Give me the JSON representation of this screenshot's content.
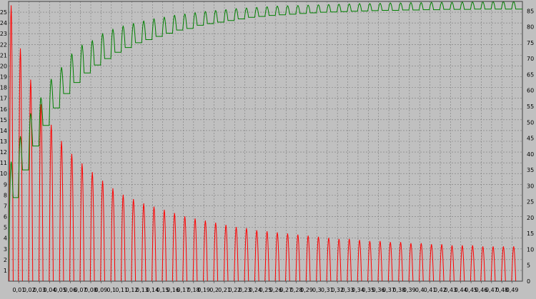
{
  "chart_data": {
    "type": "line",
    "xlabel": "",
    "ylabel_left": "",
    "ylabel_right": "",
    "x_range": [
      0,
      0.5
    ],
    "y_left_range": [
      0,
      26
    ],
    "y_right_range": [
      0,
      88
    ],
    "grid": true,
    "colors": {
      "background": "#c0c0c0",
      "grid": "#7a7a7a",
      "red_series": "#ff0000",
      "green_series": "#008000"
    },
    "x_ticks": [
      "0,01",
      "0,02",
      "0,03",
      "0,04",
      "0,05",
      "0,06",
      "0,07",
      "0,08",
      "0,09",
      "0,1",
      "0,11",
      "0,12",
      "0,13",
      "0,14",
      "0,15",
      "0,16",
      "0,17",
      "0,18",
      "0,19",
      "0,2",
      "0,21",
      "0,22",
      "0,23",
      "0,24",
      "0,25",
      "0,26",
      "0,27",
      "0,28",
      "0,29",
      "0,3",
      "0,31",
      "0,32",
      "0,33",
      "0,34",
      "0,35",
      "0,36",
      "0,37",
      "0,38",
      "0,39",
      "0,4",
      "0,41",
      "0,42",
      "0,43",
      "0,44",
      "0,45",
      "0,46",
      "0,47",
      "0,48",
      "0,49"
    ],
    "x_tick_values": [
      0.01,
      0.02,
      0.03,
      0.04,
      0.05,
      0.06,
      0.07,
      0.08,
      0.09,
      0.1,
      0.11,
      0.12,
      0.13,
      0.14,
      0.15,
      0.16,
      0.17,
      0.18,
      0.19,
      0.2,
      0.21,
      0.22,
      0.23,
      0.24,
      0.25,
      0.26,
      0.27,
      0.28,
      0.29,
      0.3,
      0.31,
      0.32,
      0.33,
      0.34,
      0.35,
      0.36,
      0.37,
      0.38,
      0.39,
      0.4,
      0.41,
      0.42,
      0.43,
      0.44,
      0.45,
      0.46,
      0.47,
      0.48,
      0.49
    ],
    "y_left_ticks": [
      1,
      2,
      3,
      4,
      5,
      6,
      7,
      8,
      9,
      10,
      11,
      12,
      13,
      14,
      15,
      16,
      17,
      18,
      19,
      20,
      21,
      22,
      23,
      24,
      25
    ],
    "y_right_ticks": [
      0,
      5,
      10,
      15,
      20,
      25,
      30,
      35,
      40,
      45,
      50,
      55,
      60,
      65,
      70,
      75,
      80,
      85
    ],
    "series": [
      {
        "axis": "left",
        "color": "#ff0000",
        "pulse_period": 0.01,
        "pulse_width": 0.004,
        "pulse_starts": [
          0.0005,
          0.0095,
          0.0195,
          0.0295,
          0.0395,
          0.0495,
          0.0595,
          0.0695,
          0.0795,
          0.0895,
          0.0995,
          0.1095,
          0.1195,
          0.1295,
          0.1395,
          0.1495,
          0.1595,
          0.1695,
          0.1795,
          0.1895,
          0.1995,
          0.2095,
          0.2195,
          0.2295,
          0.2395,
          0.2495,
          0.2595,
          0.2695,
          0.2795,
          0.2895,
          0.2995,
          0.3095,
          0.3195,
          0.3295,
          0.3395,
          0.3495,
          0.3595,
          0.3695,
          0.3795,
          0.3895,
          0.3995,
          0.4095,
          0.4195,
          0.4295,
          0.4395,
          0.4495,
          0.4595,
          0.4695,
          0.4795,
          0.4895
        ],
        "peaks": [
          25.6,
          21.6,
          18.7,
          16.4,
          14.5,
          13.0,
          11.8,
          10.9,
          10.1,
          9.3,
          8.6,
          8.0,
          7.6,
          7.2,
          6.9,
          6.6,
          6.3,
          6.0,
          5.8,
          5.6,
          5.4,
          5.2,
          5.0,
          4.9,
          4.7,
          4.6,
          4.5,
          4.4,
          4.3,
          4.2,
          4.1,
          4.0,
          3.9,
          3.9,
          3.8,
          3.7,
          3.7,
          3.6,
          3.6,
          3.5,
          3.5,
          3.4,
          3.4,
          3.3,
          3.3,
          3.3,
          3.2,
          3.2,
          3.2,
          3.2
        ]
      },
      {
        "axis": "right",
        "color": "#008000",
        "pulse_period": 0.01,
        "pulse_width": 0.004,
        "pulse_starts": [
          0.0005,
          0.0095,
          0.0195,
          0.0295,
          0.0395,
          0.0495,
          0.0595,
          0.0695,
          0.0795,
          0.0895,
          0.0995,
          0.1095,
          0.1195,
          0.1295,
          0.1395,
          0.1495,
          0.1595,
          0.1695,
          0.1795,
          0.1895,
          0.1995,
          0.2095,
          0.2195,
          0.2295,
          0.2395,
          0.2495,
          0.2595,
          0.2695,
          0.2795,
          0.2895,
          0.2995,
          0.3095,
          0.3195,
          0.3295,
          0.3395,
          0.3495,
          0.3595,
          0.3695,
          0.3795,
          0.3895,
          0.3995,
          0.4095,
          0.4195,
          0.4295,
          0.4395,
          0.4495,
          0.4595,
          0.4695,
          0.4795,
          0.4895
        ],
        "peaks": [
          37.5,
          45.5,
          52.7,
          57.7,
          63.5,
          67.2,
          71.5,
          74.2,
          75.6,
          77.8,
          79.2,
          80.2,
          81.0,
          81.8,
          82.5,
          83.0,
          83.6,
          84.0,
          84.4,
          84.8,
          85.1,
          85.4,
          85.7,
          85.9,
          86.1,
          86.3,
          86.5,
          86.6,
          86.7,
          86.8,
          86.9,
          87.0,
          87.1,
          87.2,
          87.3,
          87.3,
          87.4,
          87.5,
          87.5,
          87.6,
          87.6,
          87.7,
          87.7,
          87.7,
          87.8,
          87.8,
          87.8,
          87.9,
          87.9,
          87.9
        ],
        "baselines": [
          13.0,
          26.3,
          35.0,
          42.5,
          49.0,
          54.5,
          59.0,
          62.5,
          65.5,
          68.0,
          70.0,
          72.0,
          73.5,
          75.0,
          76.0,
          77.0,
          78.0,
          79.0,
          79.5,
          80.5,
          81.0,
          81.5,
          82.0,
          82.5,
          83.0,
          83.3,
          83.6,
          83.8,
          84.0,
          84.2,
          84.4,
          84.6,
          84.7,
          84.8,
          84.9,
          85.0,
          85.1,
          85.2,
          85.2,
          85.3,
          85.3,
          85.4,
          85.4,
          85.5,
          85.5,
          85.5,
          85.6,
          85.6,
          85.6,
          85.6
        ]
      }
    ]
  }
}
